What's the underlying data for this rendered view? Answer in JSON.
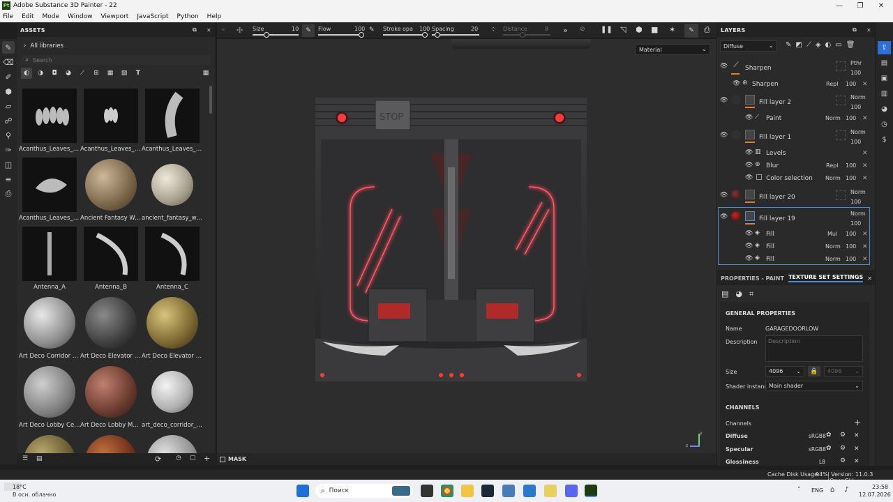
{
  "window": {
    "title": "Adobe Substance 3D Painter - 22",
    "logo": "Pt"
  },
  "menu": [
    "File",
    "Edit",
    "Mode",
    "Window",
    "Viewport",
    "JavaScript",
    "Python",
    "Help"
  ],
  "assets": {
    "title": "ASSETS",
    "library": "All libraries",
    "search_placeholder": "Search",
    "items": [
      {
        "label": "Acanthus_Leaves_01"
      },
      {
        "label": "Acanthus_Leaves_02"
      },
      {
        "label": "Acanthus_Leaves_Cu..."
      },
      {
        "label": "Acanthus_Leaves_W..."
      },
      {
        "label": "Ancient Fantasy Wor..."
      },
      {
        "label": "ancient_fantasy_worl..."
      },
      {
        "label": "Antenna_A"
      },
      {
        "label": "Antenna_B"
      },
      {
        "label": "Antenna_C"
      },
      {
        "label": "Art Deco Corridor M..."
      },
      {
        "label": "Art Deco Elevator Door"
      },
      {
        "label": "Art Deco Elevator Int..."
      },
      {
        "label": "Art Deco Lobby Ceili..."
      },
      {
        "label": "Art Deco Lobby Mar..."
      },
      {
        "label": "art_deco_corridor_m..."
      },
      {
        "label": ""
      },
      {
        "label": ""
      },
      {
        "label": ""
      }
    ]
  },
  "toolbar": {
    "size_label": "Size",
    "size_value": "10",
    "flow_label": "Flow",
    "flow_value": "100",
    "stroke_label": "Stroke opa",
    "stroke_value": "100",
    "spacing_label": "Spacing",
    "spacing_value": "20",
    "distance_label": "Distance",
    "distance_value": "8"
  },
  "viewport": {
    "channel": "Material",
    "mask_label": "MASK",
    "axis_z": "z",
    "axis_y": "y",
    "stop_sign": "STOP"
  },
  "layers": {
    "title": "LAYERS",
    "channel": "Diffuse",
    "rows": [
      {
        "name": "Sharpen",
        "blend": "Pthr",
        "opacity": "100",
        "kind": "layer"
      },
      {
        "name": "Sharpen",
        "blend": "Repl",
        "opacity": "100",
        "kind": "effect"
      },
      {
        "name": "Fill layer 2",
        "blend": "Norm",
        "opacity": "100",
        "kind": "layer"
      },
      {
        "name": "Paint",
        "blend": "Norm",
        "opacity": "100",
        "kind": "effect"
      },
      {
        "name": "Fill layer 1",
        "blend": "Norm",
        "opacity": "100",
        "kind": "layer"
      },
      {
        "name": "Levels",
        "blend": "",
        "opacity": "",
        "kind": "effect"
      },
      {
        "name": "Blur",
        "blend": "Repl",
        "opacity": "100",
        "kind": "effect"
      },
      {
        "name": "Color selection",
        "blend": "Norm",
        "opacity": "100",
        "kind": "effect"
      },
      {
        "name": "Fill layer 20",
        "blend": "Norm",
        "opacity": "100",
        "kind": "layer"
      },
      {
        "name": "Fill layer 19",
        "blend": "Norm",
        "opacity": "100",
        "kind": "layer"
      },
      {
        "name": "Fill",
        "blend": "Mul",
        "opacity": "100",
        "kind": "effect"
      },
      {
        "name": "Fill",
        "blend": "Norm",
        "opacity": "100",
        "kind": "effect"
      },
      {
        "name": "Fill",
        "blend": "Norm",
        "opacity": "100",
        "kind": "effect"
      }
    ]
  },
  "properties": {
    "tab1": "PROPERTIES - PAINT",
    "tab2": "TEXTURE SET SETTINGS",
    "general": "GENERAL PROPERTIES",
    "name_label": "Name",
    "name_value": "GARAGEDOORLOW",
    "desc_label": "Description",
    "desc_placeholder": "Description",
    "size_label": "Size",
    "size_value": "4096",
    "size_value2": "4096",
    "shader_label": "Shader instance",
    "shader_value": "Main shader",
    "channels_header": "CHANNELS",
    "channels_label": "Channels",
    "channels": [
      {
        "name": "Diffuse",
        "format": "sRGB8"
      },
      {
        "name": "Specular",
        "format": "sRGB8"
      },
      {
        "name": "Glossiness",
        "format": "L8"
      }
    ]
  },
  "status": {
    "cache": "Cache Disk Usage:",
    "cache_value": "94%",
    "version": "| Version: 11.0.3 (OpenGL)"
  },
  "taskbar": {
    "temp": "18°C",
    "weather": "В осн. облачно",
    "search": "Поиск",
    "lang": "ENG",
    "time": "23:58",
    "date": "12.07.2026"
  }
}
